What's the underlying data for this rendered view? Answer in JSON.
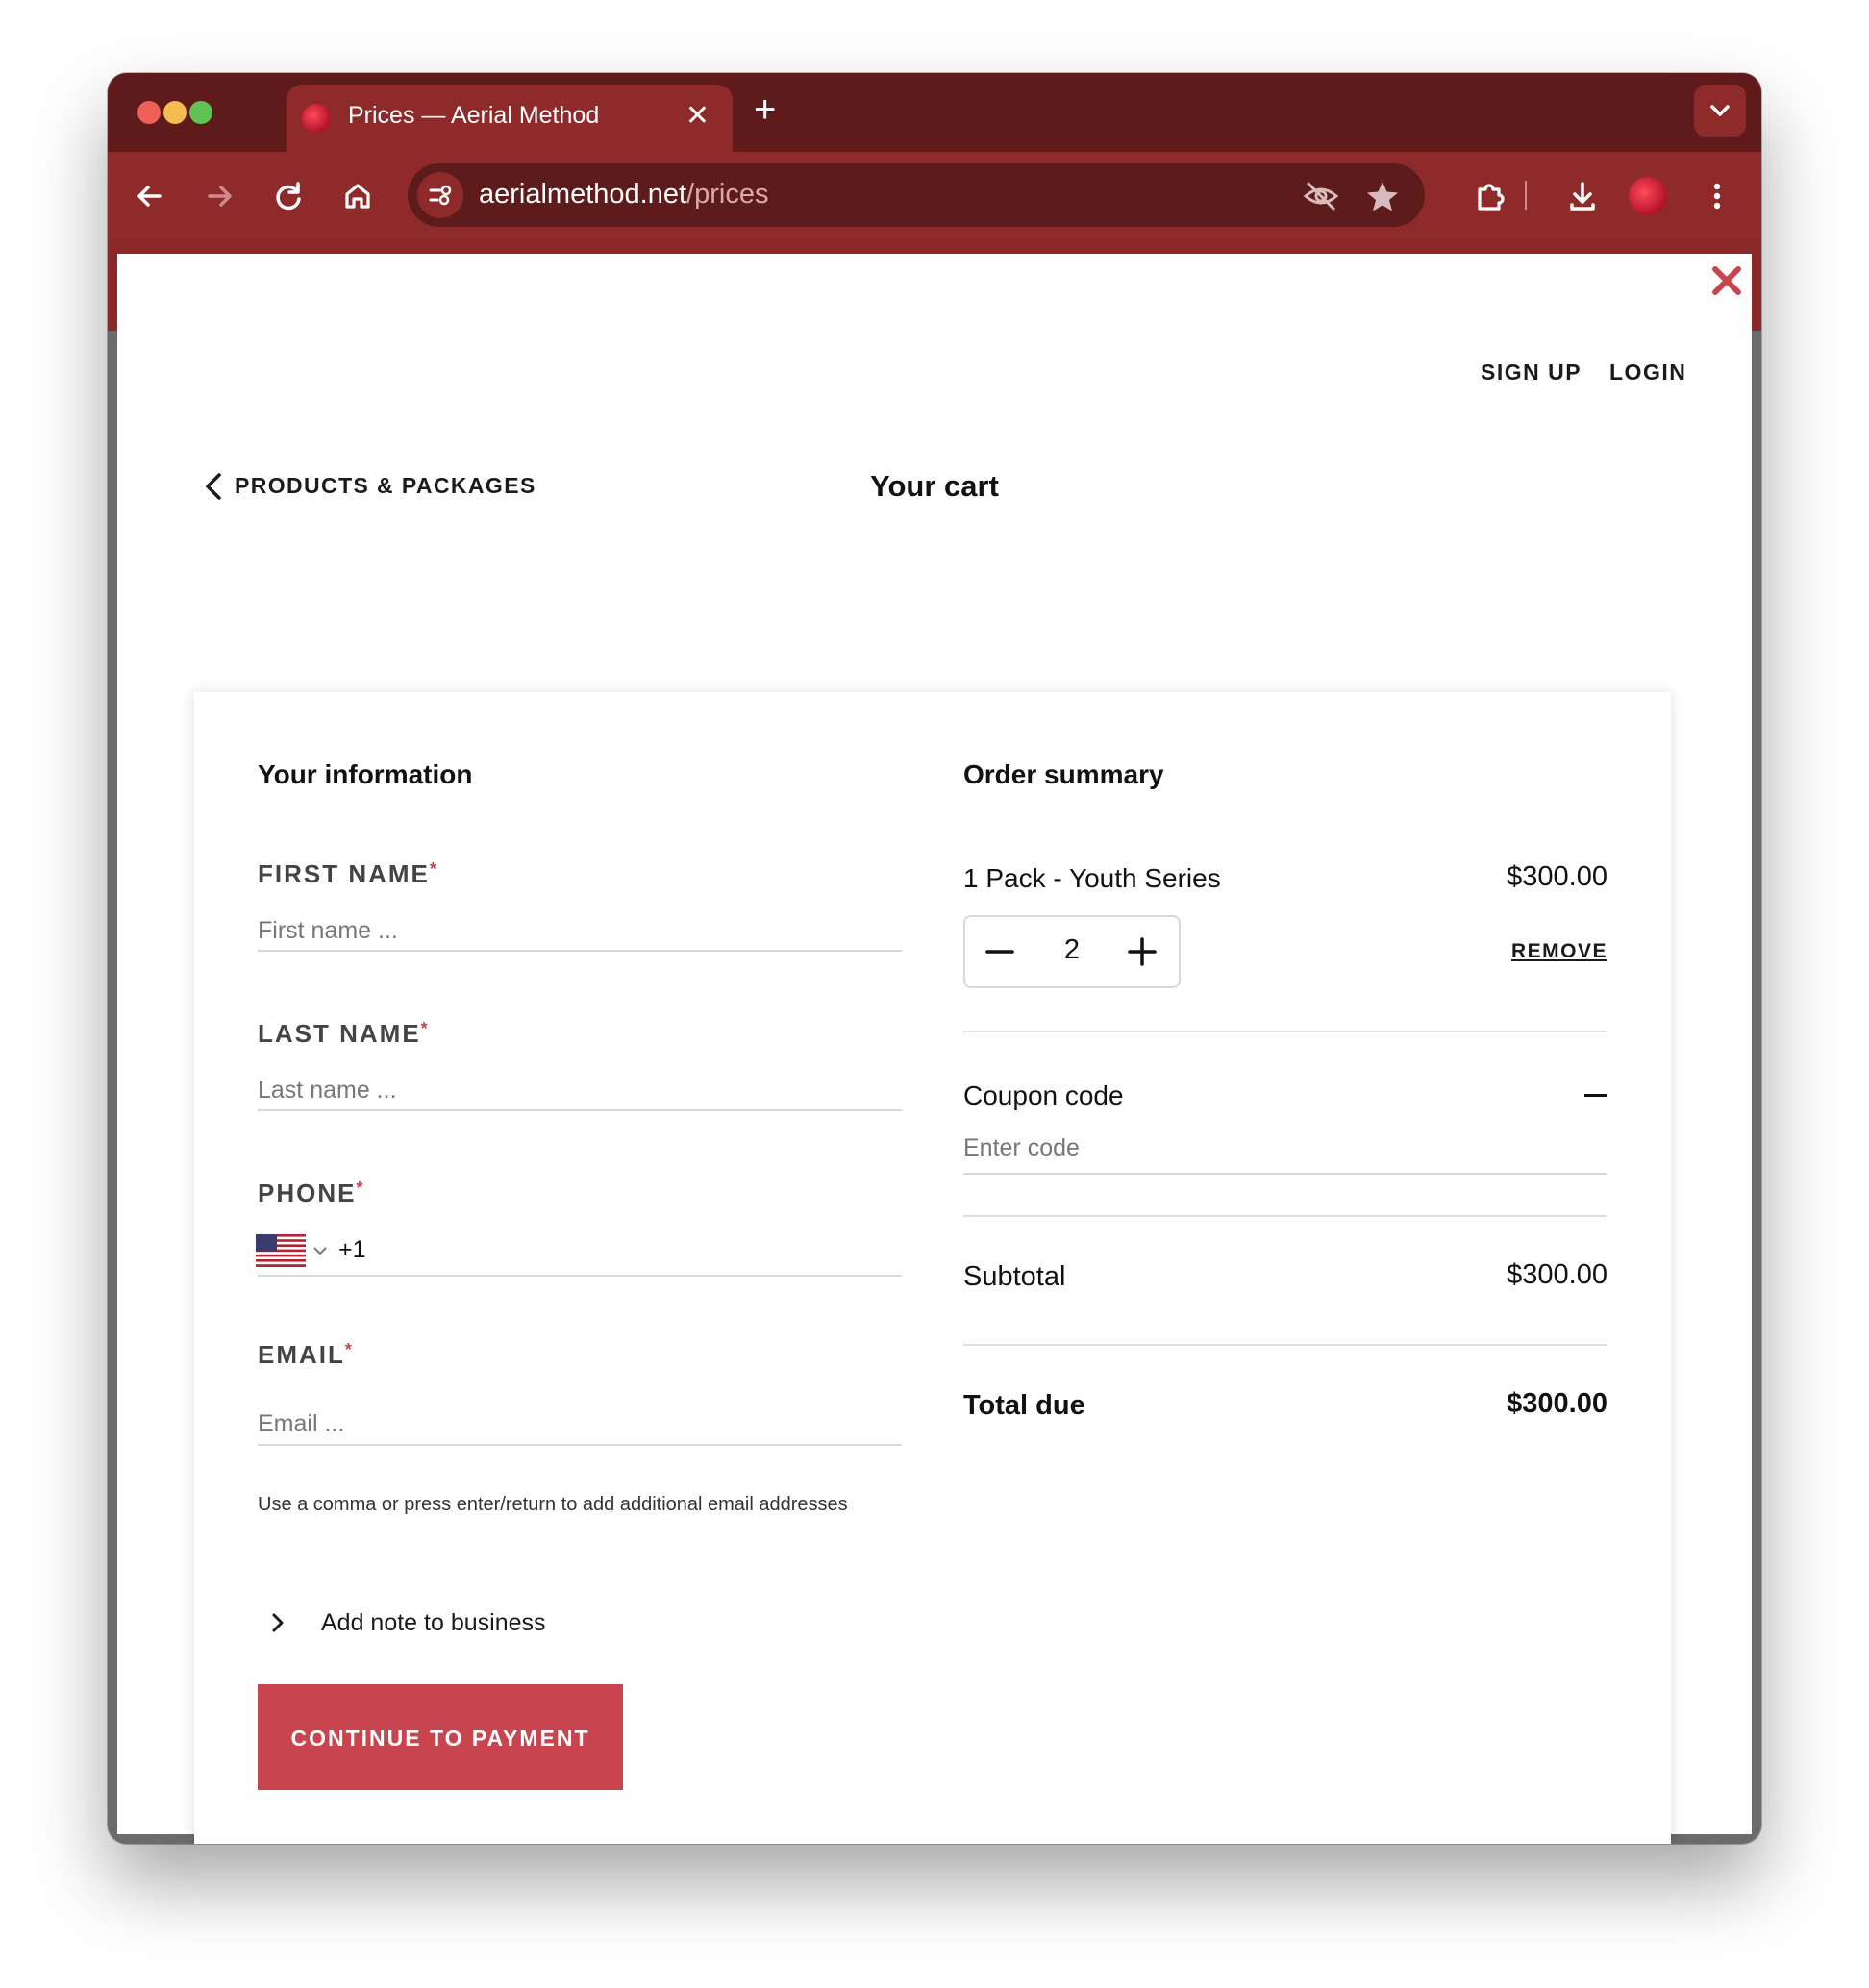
{
  "browser": {
    "tab_title": "Prices — Aerial Method",
    "url_domain": "aerialmethod.net",
    "url_path": "/prices",
    "accent": "#8e2a2a"
  },
  "page": {
    "nav": {
      "signup": "SIGN UP",
      "login": "LOGIN"
    },
    "back_label": "PRODUCTS & PACKAGES",
    "title": "Your cart"
  },
  "form": {
    "heading": "Your information",
    "first_name": {
      "label": "FIRST NAME",
      "placeholder": "First name ..."
    },
    "last_name": {
      "label": "LAST NAME",
      "placeholder": "Last name ..."
    },
    "phone": {
      "label": "PHONE",
      "country_code": "+1"
    },
    "email": {
      "label": "EMAIL",
      "placeholder": "Email ...",
      "helper": "Use a comma or press enter/return to add additional email addresses"
    },
    "required_mark": "*",
    "note_label": "Add note to business",
    "cta": "CONTINUE TO PAYMENT",
    "cta_color": "#c8454f"
  },
  "summary": {
    "heading": "Order summary",
    "item": {
      "name": "1 Pack - Youth Series",
      "price": "$300.00",
      "quantity": "2",
      "remove": "REMOVE"
    },
    "coupon": {
      "label": "Coupon code",
      "placeholder": "Enter code"
    },
    "subtotal": {
      "label": "Subtotal",
      "value": "$300.00"
    },
    "total": {
      "label": "Total due",
      "value": "$300.00"
    }
  }
}
